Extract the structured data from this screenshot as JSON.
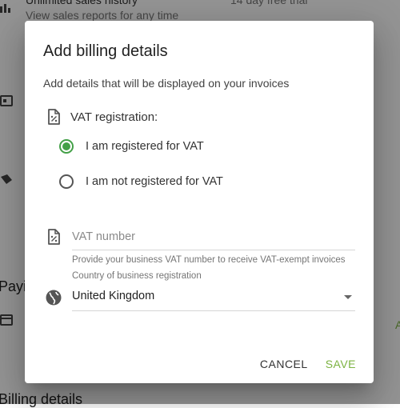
{
  "background": {
    "line1": "Unlimited sales history",
    "line1_right": "14 day free trial",
    "line2": "View sales reports for any time",
    "section_payments": "Payi",
    "section_billing": "Billing details",
    "right_letter": "A"
  },
  "dialog": {
    "title": "Add billing details",
    "subtitle": "Add details that will be displayed on your invoices",
    "vat_registration_label": "VAT registration:",
    "radio_options": [
      {
        "label": "I am registered for VAT",
        "checked": true
      },
      {
        "label": "I am not registered for VAT",
        "checked": false
      }
    ],
    "vat_number": {
      "value": "",
      "placeholder": "VAT number",
      "hint": "Provide your business VAT number to receive VAT-exempt invoices"
    },
    "country": {
      "label": "Country of business registration",
      "value": "United Kingdom"
    },
    "buttons": {
      "cancel": "CANCEL",
      "save": "SAVE"
    }
  },
  "colors": {
    "accent_green": "#43a047",
    "save_green": "#7cb342",
    "overlay": "rgba(0,0,0,0.42)"
  }
}
